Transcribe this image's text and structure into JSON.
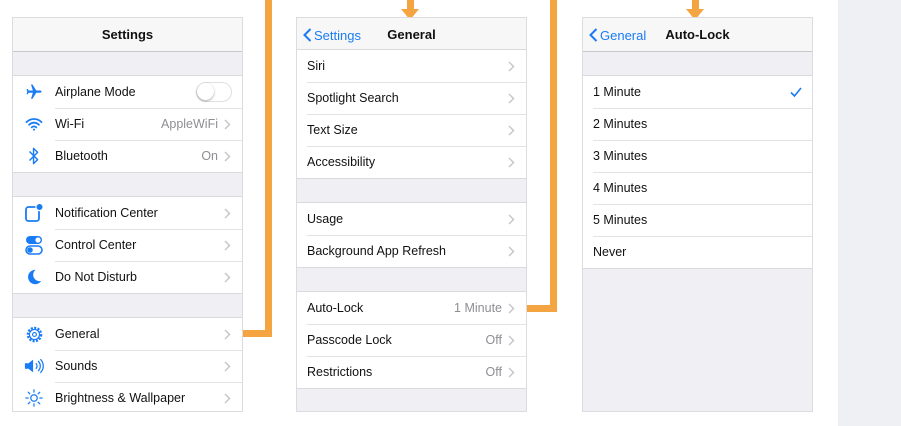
{
  "colors": {
    "accent": "#1a7cf5",
    "connector": "#f5a442",
    "background": "#efeff4"
  },
  "settings": {
    "title": "Settings",
    "group1": [
      {
        "label": "Airplane Mode",
        "icon": "airplane-icon",
        "control": "toggle"
      },
      {
        "label": "Wi-Fi",
        "icon": "wifi-icon",
        "value": "AppleWiFi"
      },
      {
        "label": "Bluetooth",
        "icon": "bluetooth-icon",
        "value": "On"
      }
    ],
    "group2": [
      {
        "label": "Notification Center",
        "icon": "notification-center-icon"
      },
      {
        "label": "Control Center",
        "icon": "control-center-icon"
      },
      {
        "label": "Do Not Disturb",
        "icon": "moon-icon"
      }
    ],
    "group3": [
      {
        "label": "General",
        "icon": "gear-icon"
      },
      {
        "label": "Sounds",
        "icon": "speaker-icon"
      },
      {
        "label": "Brightness & Wallpaper",
        "icon": "sun-icon"
      }
    ]
  },
  "general": {
    "back": "Settings",
    "title": "General",
    "group1": [
      {
        "label": "Siri"
      },
      {
        "label": "Spotlight Search"
      },
      {
        "label": "Text Size"
      },
      {
        "label": "Accessibility"
      }
    ],
    "group2": [
      {
        "label": "Usage"
      },
      {
        "label": "Background App Refresh"
      }
    ],
    "group3": [
      {
        "label": "Auto-Lock",
        "value": "1 Minute"
      },
      {
        "label": "Passcode Lock",
        "value": "Off"
      },
      {
        "label": "Restrictions",
        "value": "Off"
      }
    ]
  },
  "autolock": {
    "back": "General",
    "title": "Auto-Lock",
    "options": [
      {
        "label": "1 Minute",
        "selected": true
      },
      {
        "label": "2 Minutes"
      },
      {
        "label": "3 Minutes"
      },
      {
        "label": "4 Minutes"
      },
      {
        "label": "5 Minutes"
      },
      {
        "label": "Never"
      }
    ]
  }
}
